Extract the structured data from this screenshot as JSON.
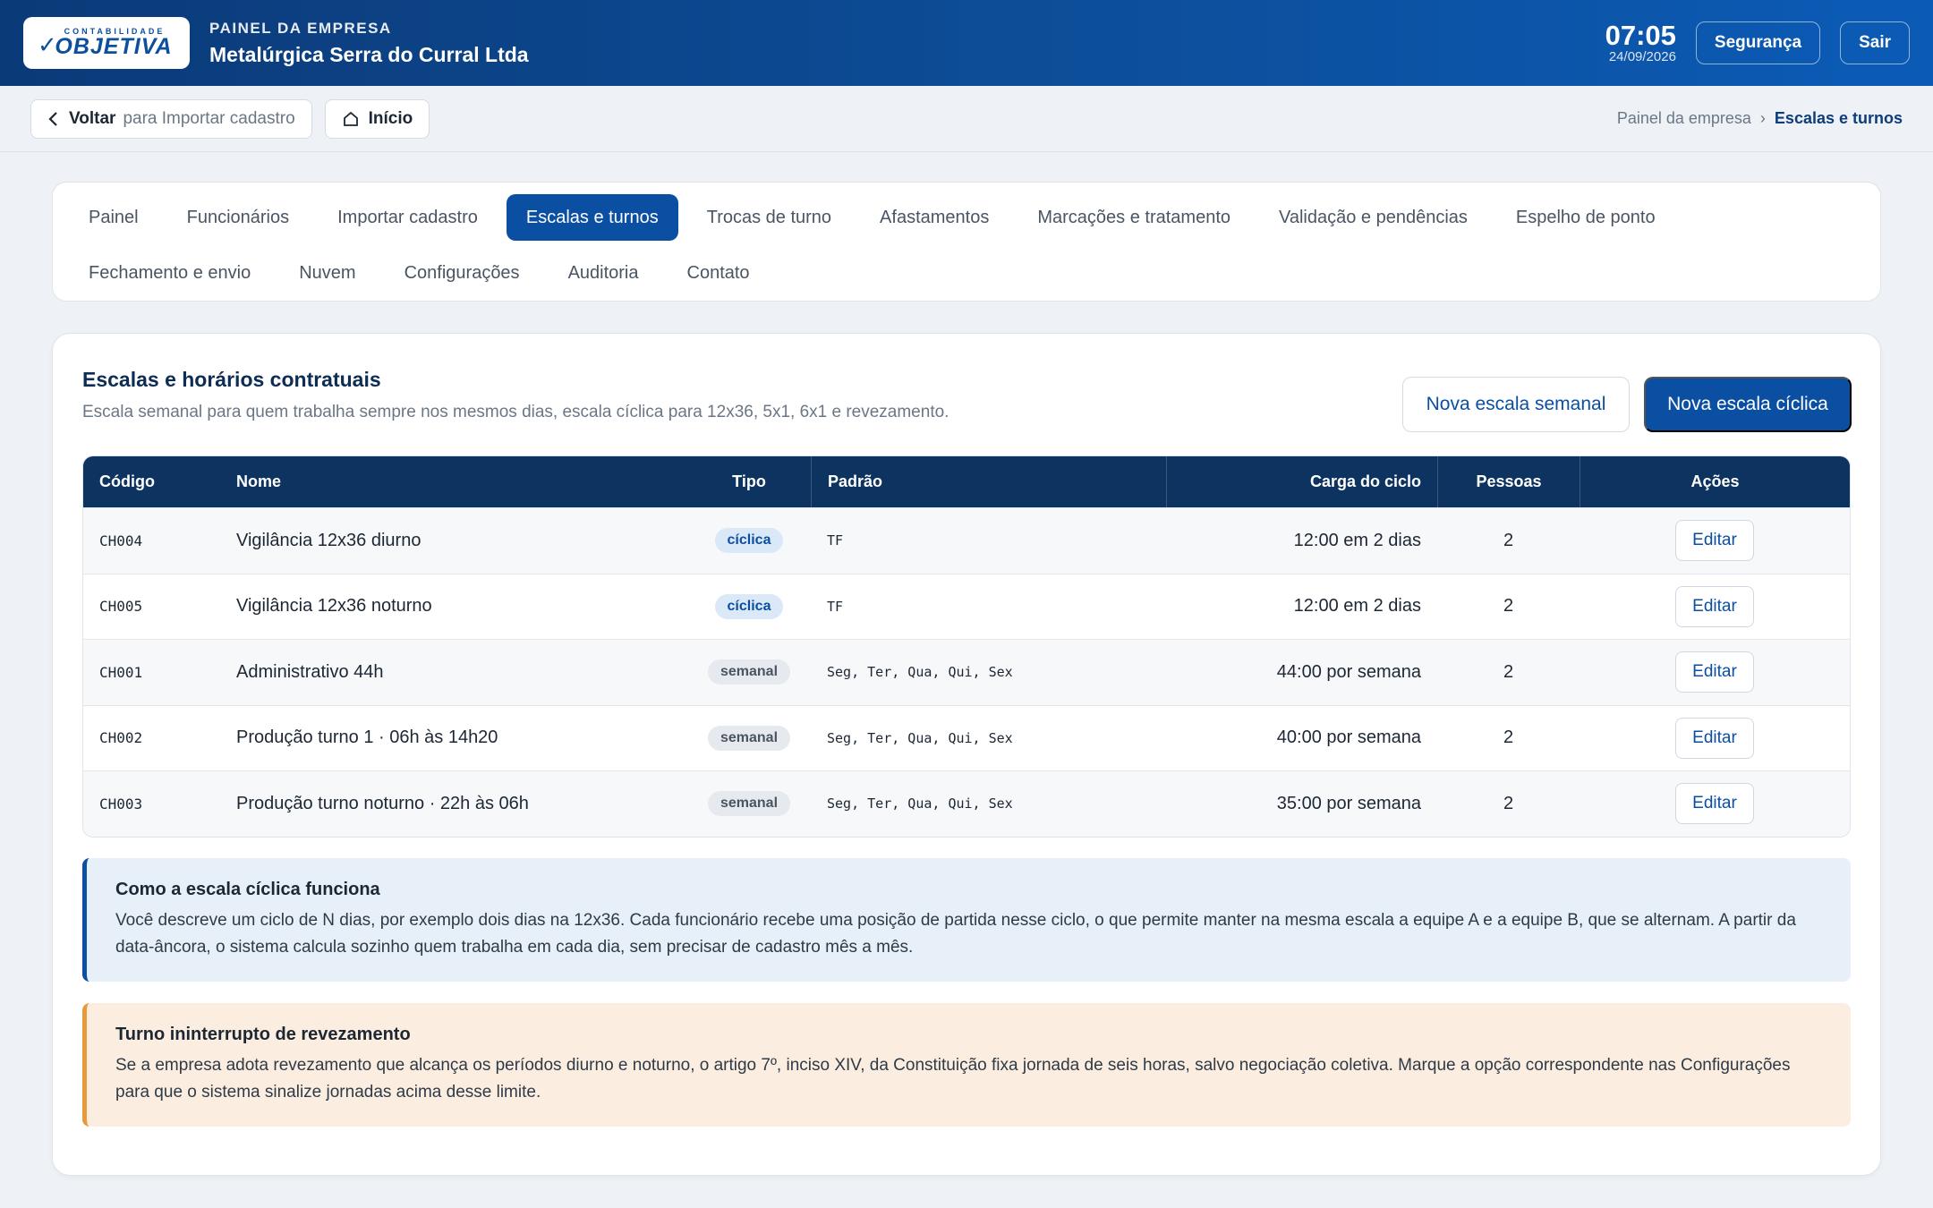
{
  "header": {
    "logo_small": "CONTABILIDADE",
    "logo_big": "OBJETIVA",
    "company_label": "PAINEL DA EMPRESA",
    "company_name": "Metalúrgica Serra do Curral Ltda",
    "time": "07:05",
    "date": "24/09/2026",
    "security_label": "Segurança",
    "logout_label": "Sair"
  },
  "subbar": {
    "back_label": "Voltar",
    "back_hint": "para Importar cadastro",
    "home_label": "Início",
    "breadcrumb": [
      "Painel da empresa",
      "Escalas e turnos"
    ]
  },
  "tabs_row1": [
    "Painel",
    "Funcionários",
    "Importar cadastro",
    "Escalas e turnos",
    "Trocas de turno",
    "Afastamentos",
    "Marcações e tratamento",
    "Validação e pendências",
    "Espelho de ponto"
  ],
  "tabs_row2": [
    "Fechamento e envio",
    "Nuvem",
    "Configurações",
    "Auditoria",
    "Contato"
  ],
  "active_tab": "Escalas e turnos",
  "main": {
    "title": "Escalas e horários contratuais",
    "subtitle": "Escala semanal para quem trabalha sempre nos mesmos dias, escala cíclica para 12x36, 5x1, 6x1 e revezamento.",
    "btn_weekly": "Nova escala semanal",
    "btn_cyclic": "Nova escala cíclica"
  },
  "table": {
    "columns": [
      "Código",
      "Nome",
      "Tipo",
      "Padrão",
      "Carga do ciclo",
      "Pessoas",
      "Ações"
    ],
    "rows": [
      {
        "code": "CH004",
        "name": "Vigilância 12x36 diurno",
        "type": "cíclica",
        "pattern": "TF",
        "load": "12:00 em 2 dias",
        "people": "2",
        "action": "Editar"
      },
      {
        "code": "CH005",
        "name": "Vigilância 12x36 noturno",
        "type": "cíclica",
        "pattern": "TF",
        "load": "12:00 em 2 dias",
        "people": "2",
        "action": "Editar"
      },
      {
        "code": "CH001",
        "name": "Administrativo 44h",
        "type": "semanal",
        "pattern": "Seg, Ter, Qua, Qui, Sex",
        "load": "44:00 por semana",
        "people": "2",
        "action": "Editar"
      },
      {
        "code": "CH002",
        "name": "Produção turno 1 · 06h às 14h20",
        "type": "semanal",
        "pattern": "Seg, Ter, Qua, Qui, Sex",
        "load": "40:00 por semana",
        "people": "2",
        "action": "Editar"
      },
      {
        "code": "CH003",
        "name": "Produção turno noturno · 22h às 06h",
        "type": "semanal",
        "pattern": "Seg, Ter, Qua, Qui, Sex",
        "load": "35:00 por semana",
        "people": "2",
        "action": "Editar"
      }
    ]
  },
  "notes": {
    "cyclic_title": "Como a escala cíclica funciona",
    "cyclic_text": "Você descreve um ciclo de N dias, por exemplo dois dias na 12x36. Cada funcionário recebe uma posição de partida nesse ciclo, o que permite manter na mesma escala a equipe A e a equipe B, que se alternam. A partir da data-âncora, o sistema calcula sozinho quem trabalha em cada dia, sem precisar de cadastro mês a mês.",
    "shift_title": "Turno ininterrupto de revezamento",
    "shift_text": "Se a empresa adota revezamento que alcança os períodos diurno e noturno, o artigo 7º, inciso XIV, da Constituição fixa jornada de seis horas, salvo negociação coletiva. Marque a opção correspondente nas Configurações para que o sistema sinalize jornadas acima desse limite."
  }
}
